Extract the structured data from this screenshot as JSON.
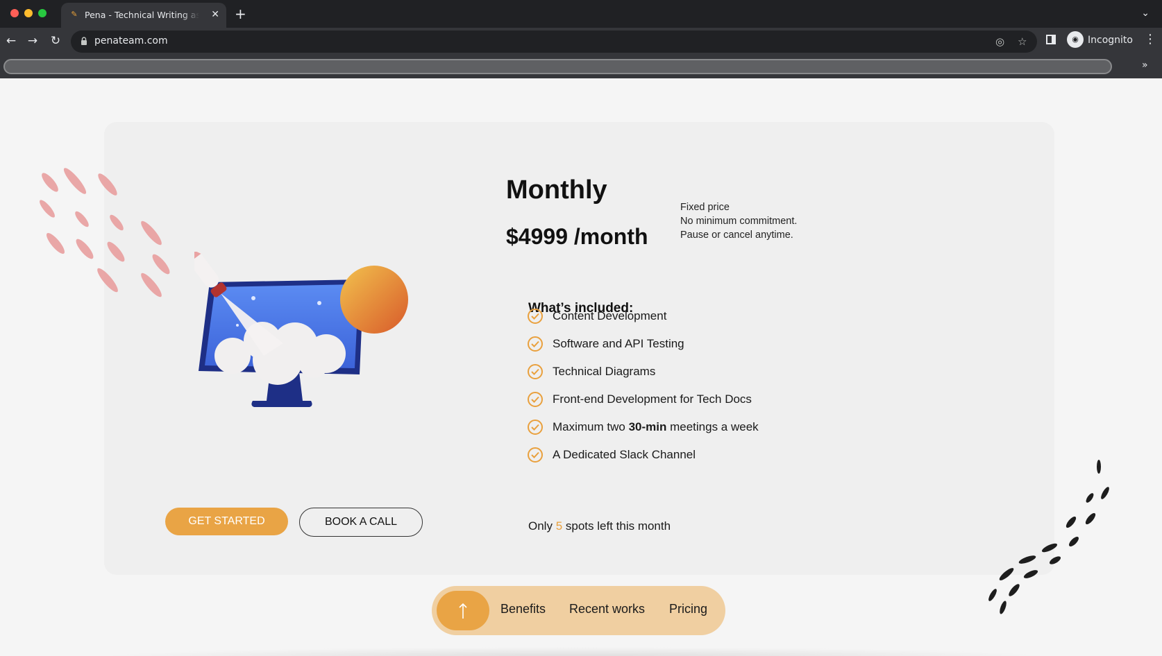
{
  "browser": {
    "tab_title": "Pena - Technical Writing as a Service",
    "new_tab_glyph": "+",
    "url": "penateam.com",
    "profile_label": "Incognito",
    "bookmarks_more": "»"
  },
  "pricing": {
    "plan_title": "Monthly",
    "price": "$4999 /month",
    "notes": [
      "Fixed price",
      "No minimum commitment.",
      "Pause or cancel anytime."
    ],
    "included_title": "What’s included:",
    "features": [
      {
        "text": "Content Development"
      },
      {
        "text": "Software and API Testing"
      },
      {
        "text": "Technical Diagrams"
      },
      {
        "text": "Front-end Development for Tech Docs"
      },
      {
        "pre": "Maximum two ",
        "bold": "30-min",
        "post": " meetings a week"
      },
      {
        "text": "A Dedicated Slack Channel"
      }
    ],
    "spots": {
      "pre": "Only ",
      "count": "5",
      "post": " spots left this month"
    },
    "get_started_label": "GET STARTED",
    "book_call_label": "BOOK A CALL"
  },
  "bottom_nav": {
    "links": [
      "Benefits",
      "Recent works",
      "Pricing"
    ]
  },
  "colors": {
    "accent": "#e9a445",
    "nav_bg": "#f0cfa1",
    "card_bg": "#efefef",
    "monitor_blue": "#4e7df0"
  },
  "icons": [
    "back-arrow-icon",
    "forward-arrow-icon",
    "reload-icon",
    "lock-icon",
    "eye-off-icon",
    "star-icon",
    "side-panel-icon",
    "incognito-icon",
    "kebab-menu-icon",
    "check-circle-icon",
    "arrow-up-icon"
  ]
}
